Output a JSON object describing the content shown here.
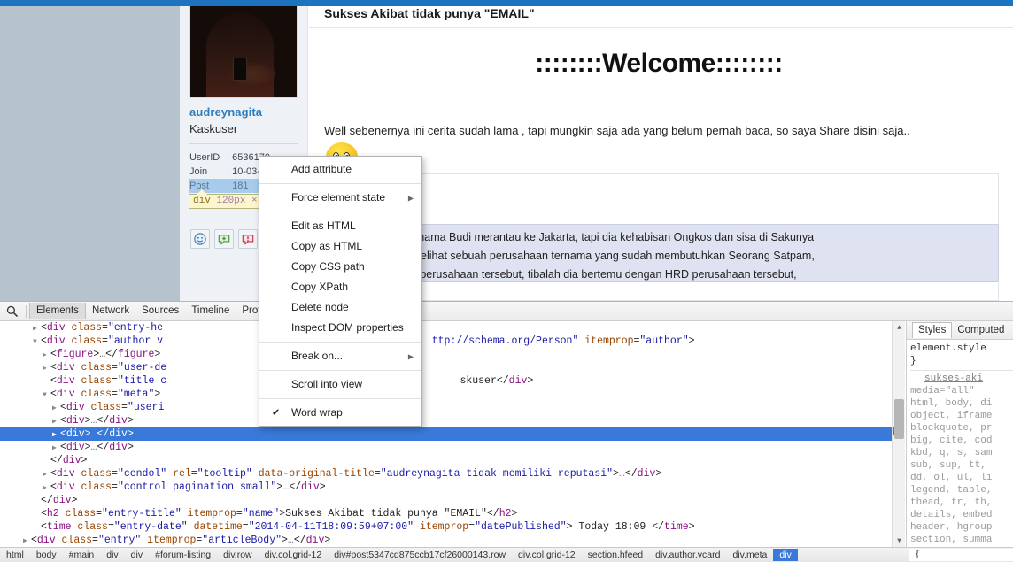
{
  "page": {
    "entry_title": "Sukses Akibat tidak punya \"EMAIL\"",
    "welcome_heading": "::::::::Welcome::::::::",
    "intro_paragraph": "Well sebenernya ini cerita sudah lama , tapi mungkin saja ada yang belum pernah baca, so saya Share disini saja..",
    "quote_line_1": "seorang yang bernama Budi merantau ke Jakarta, tapi dia kehabisan Ongkos dan sisa di Sakunya",
    "quote_line_2": "5ribu saja. Budi melihat sebuah perusahaan ternama yang sudah membutuhkan Seorang Satpam,",
    "quote_line_3": "untuk melamar di perusahaan tersebut, tibalah dia bertemu dengan HRD perusahaan tersebut,"
  },
  "author": {
    "avatar_alt": "audreynagita-avatar",
    "username": "audreynagita",
    "rank": "Kaskuser",
    "meta": [
      {
        "key": "UserID",
        "sep": ":",
        "value": "6536170",
        "selected": false
      },
      {
        "key": "Join",
        "sep": ":",
        "value": "10-03-",
        "selected": false
      },
      {
        "key": "Post",
        "sep": ":",
        "value": "181",
        "selected": true
      }
    ],
    "reputation_icons": [
      "smiley-icon",
      "add-reputation-icon",
      "report-icon"
    ]
  },
  "inspector_tooltip": {
    "tag": "div",
    "dimensions": "120px",
    "times": "×"
  },
  "devtools": {
    "search_icon": "search-icon",
    "tabs": [
      {
        "label": "Elements",
        "active": true
      },
      {
        "label": "Network",
        "active": false
      },
      {
        "label": "Sources",
        "active": false
      },
      {
        "label": "Timeline",
        "active": false
      },
      {
        "label": "Profile",
        "active": false
      }
    ],
    "dom_lines": [
      {
        "indent": 3,
        "tri": "▶",
        "html": "&lt;<span class=\"tagname\">div</span> <span class=\"attr\">class</span>=<span class=\"val\">\"entry-he</span>",
        "selected": false
      },
      {
        "indent": 3,
        "tri": "▼",
        "html": "&lt;<span class=\"tagname\">div</span> <span class=\"attr\">class</span>=<span class=\"val\">\"author v</span>&nbsp;&nbsp;&nbsp;&nbsp;&nbsp;&nbsp;&nbsp;&nbsp;&nbsp;&nbsp;&nbsp;&nbsp;&nbsp;&nbsp;&nbsp;&nbsp;&nbsp;&nbsp;&nbsp;&nbsp;&nbsp;&nbsp;&nbsp;&nbsp;&nbsp;&nbsp;&nbsp;&nbsp;&nbsp;&nbsp;&nbsp;&nbsp;&nbsp;&nbsp;&nbsp;&nbsp;&nbsp;&nbsp;&nbsp;&nbsp;&nbsp;&nbsp;&nbsp;&nbsp;<span class=\"val\">ttp://schema.org/Person\"</span> <span class=\"attr\">itemprop</span>=<span class=\"val\">\"author\"</span>&gt;",
        "selected": false
      },
      {
        "indent": 4,
        "tri": "▶",
        "html": "&lt;<span class=\"tagname\">figure</span>&gt;<span class=\"ellip\">…</span>&lt;/<span class=\"tagname\">figure</span>&gt;",
        "selected": false
      },
      {
        "indent": 4,
        "tri": "▶",
        "html": "&lt;<span class=\"tagname\">div</span> <span class=\"attr\">class</span>=<span class=\"val\">\"user-de</span>",
        "selected": false
      },
      {
        "indent": 4,
        "tri": " ",
        "html": "&lt;<span class=\"tagname\">div</span> <span class=\"attr\">class</span>=<span class=\"val\">\"title c</span>&nbsp;&nbsp;&nbsp;&nbsp;&nbsp;&nbsp;&nbsp;&nbsp;&nbsp;&nbsp;&nbsp;&nbsp;&nbsp;&nbsp;&nbsp;&nbsp;&nbsp;&nbsp;&nbsp;&nbsp;&nbsp;&nbsp;&nbsp;&nbsp;&nbsp;&nbsp;&nbsp;&nbsp;&nbsp;&nbsp;&nbsp;&nbsp;&nbsp;&nbsp;&nbsp;&nbsp;&nbsp;&nbsp;&nbsp;&nbsp;&nbsp;&nbsp;&nbsp;&nbsp;&nbsp;&nbsp;&nbsp;&nbsp;<span class=\"txt\">skuser</span>&lt;/<span class=\"tagname\">div</span>&gt;",
        "selected": false
      },
      {
        "indent": 4,
        "tri": "▼",
        "html": "&lt;<span class=\"tagname\">div</span> <span class=\"attr\">class</span>=<span class=\"val\">\"meta\"</span>&gt;",
        "selected": false
      },
      {
        "indent": 5,
        "tri": "▶",
        "html": "&lt;<span class=\"tagname\">div</span> <span class=\"attr\">class</span>=<span class=\"val\">\"useri</span>",
        "selected": false
      },
      {
        "indent": 5,
        "tri": "▶",
        "html": "&lt;<span class=\"tagname\">div</span>&gt;<span class=\"ellip\">…</span>&lt;/<span class=\"tagname\">div</span>&gt;",
        "selected": false
      },
      {
        "indent": 5,
        "tri": "▶",
        "html": "&lt;<span class=\"tagname\">div</span>&gt;<span class=\"ellip\">…</span>&lt;/<span class=\"tagname\">div</span>&gt;",
        "selected": true
      },
      {
        "indent": 5,
        "tri": "▶",
        "html": "&lt;<span class=\"tagname\">div</span>&gt;<span class=\"ellip\">…</span>&lt;/<span class=\"tagname\">div</span>&gt;",
        "selected": false
      },
      {
        "indent": 4,
        "tri": " ",
        "html": "&lt;/<span class=\"tagname\">div</span>&gt;",
        "selected": false
      },
      {
        "indent": 4,
        "tri": "▶",
        "html": "&lt;<span class=\"tagname\">div</span> <span class=\"attr\">class</span>=<span class=\"val\">\"cendol\"</span> <span class=\"attr\">rel</span>=<span class=\"val\">\"tooltip\"</span> <span class=\"attr\">data-original-title</span>=<span class=\"val\">\"audreynagita tidak memiliki reputasi\"</span>&gt;<span class=\"ellip\">…</span>&lt;/<span class=\"tagname\">div</span>&gt;",
        "selected": false
      },
      {
        "indent": 4,
        "tri": "▶",
        "html": "&lt;<span class=\"tagname\">div</span> <span class=\"attr\">class</span>=<span class=\"val\">\"control pagination small\"</span>&gt;<span class=\"ellip\">…</span>&lt;/<span class=\"tagname\">div</span>&gt;",
        "selected": false
      },
      {
        "indent": 3,
        "tri": " ",
        "html": "&lt;/<span class=\"tagname\">div</span>&gt;",
        "selected": false
      },
      {
        "indent": 3,
        "tri": " ",
        "html": "&lt;<span class=\"tagname\">h2</span> <span class=\"attr\">class</span>=<span class=\"val\">\"entry-title\"</span> <span class=\"attr\">itemprop</span>=<span class=\"val\">\"name\"</span>&gt;<span class=\"txt\">Sukses Akibat tidak punya \"EMAIL\"</span>&lt;/<span class=\"tagname\">h2</span>&gt;",
        "selected": false
      },
      {
        "indent": 3,
        "tri": " ",
        "html": "&lt;<span class=\"tagname\">time</span> <span class=\"attr\">class</span>=<span class=\"val\">\"entry-date\"</span> <span class=\"attr\">datetime</span>=<span class=\"val\">\"2014-04-11T18:09:59+07:00\"</span> <span class=\"attr\">itemprop</span>=<span class=\"val\">\"datePublished\"</span>&gt;<span class=\"txt\"> Today 18:09 </span>&lt;/<span class=\"tagname\">time</span>&gt;",
        "selected": false
      },
      {
        "indent": 2,
        "tri": "▶",
        "html": "&lt;<span class=\"tagname\">div</span> <span class=\"attr\">class</span>=<span class=\"val\">\"entry\"</span> <span class=\"attr\">itemprop</span>=<span class=\"val\">\"articleBody\"</span>&gt;<span class=\"ellip\">…</span>&lt;/<span class=\"tagname\">div</span>&gt;",
        "selected": false
      }
    ],
    "styles": {
      "tabs": [
        {
          "label": "Styles",
          "active": true
        },
        {
          "label": "Computed",
          "active": false
        }
      ],
      "element_style": "element.style",
      "element_style_close": "}",
      "rule_source": "sukses-aki",
      "rule_media": "media=\"all\"",
      "selector_lines": [
        "html, body, di",
        "object, iframe",
        "blockquote, pr",
        "big, cite, cod",
        "kbd, q, s, sam",
        "sub, sup, tt,",
        "dd, ol, ul, li",
        "legend, table,",
        "thead, tr, th,",
        "details, embed",
        "header, hgroup",
        "section, summa"
      ],
      "brace_open": "{"
    },
    "breadcrumbs": [
      {
        "label": "html",
        "active": false
      },
      {
        "label": "body",
        "active": false
      },
      {
        "label": "#main",
        "active": false
      },
      {
        "label": "div",
        "active": false
      },
      {
        "label": "div",
        "active": false
      },
      {
        "label": "#forum-listing",
        "active": false
      },
      {
        "label": "div.row",
        "active": false
      },
      {
        "label": "div.col.grid-12",
        "active": false
      },
      {
        "label": "div#post5347cd875ccb17cf26000143.row",
        "active": false
      },
      {
        "label": "div.col.grid-12",
        "active": false
      },
      {
        "label": "section.hfeed",
        "active": false
      },
      {
        "label": "div.author.vcard",
        "active": false
      },
      {
        "label": "div.meta",
        "active": false
      },
      {
        "label": "div",
        "active": true
      }
    ],
    "styles_overflow_brace": "{"
  },
  "context_menu": {
    "items": [
      {
        "label": "Add attribute",
        "submenu": false,
        "checked": false,
        "sep_after": true
      },
      {
        "label": "Force element state",
        "submenu": true,
        "checked": false,
        "sep_after": true
      },
      {
        "label": "Edit as HTML",
        "submenu": false,
        "checked": false,
        "sep_after": false
      },
      {
        "label": "Copy as HTML",
        "submenu": false,
        "checked": false,
        "sep_after": false
      },
      {
        "label": "Copy CSS path",
        "submenu": false,
        "checked": false,
        "sep_after": false
      },
      {
        "label": "Copy XPath",
        "submenu": false,
        "checked": false,
        "sep_after": false
      },
      {
        "label": "Delete node",
        "submenu": false,
        "checked": false,
        "sep_after": false
      },
      {
        "label": "Inspect DOM properties",
        "submenu": false,
        "checked": false,
        "sep_after": true
      },
      {
        "label": "Break on...",
        "submenu": true,
        "checked": false,
        "sep_after": true
      },
      {
        "label": "Scroll into view",
        "submenu": false,
        "checked": false,
        "sep_after": true
      },
      {
        "label": "Word wrap",
        "submenu": false,
        "checked": true,
        "sep_after": false
      }
    ],
    "submenu_arrow": "▶",
    "check_glyph": "✔"
  },
  "colors": {
    "topbar_blue": "#1e73be",
    "selection_blue": "#3879d9",
    "quote_bg": "#dfe2f0",
    "tooltip_yellow": "#fdf6cd",
    "page_bg_gray": "#b6c3cc",
    "username_blue": "#2d7dbf"
  }
}
